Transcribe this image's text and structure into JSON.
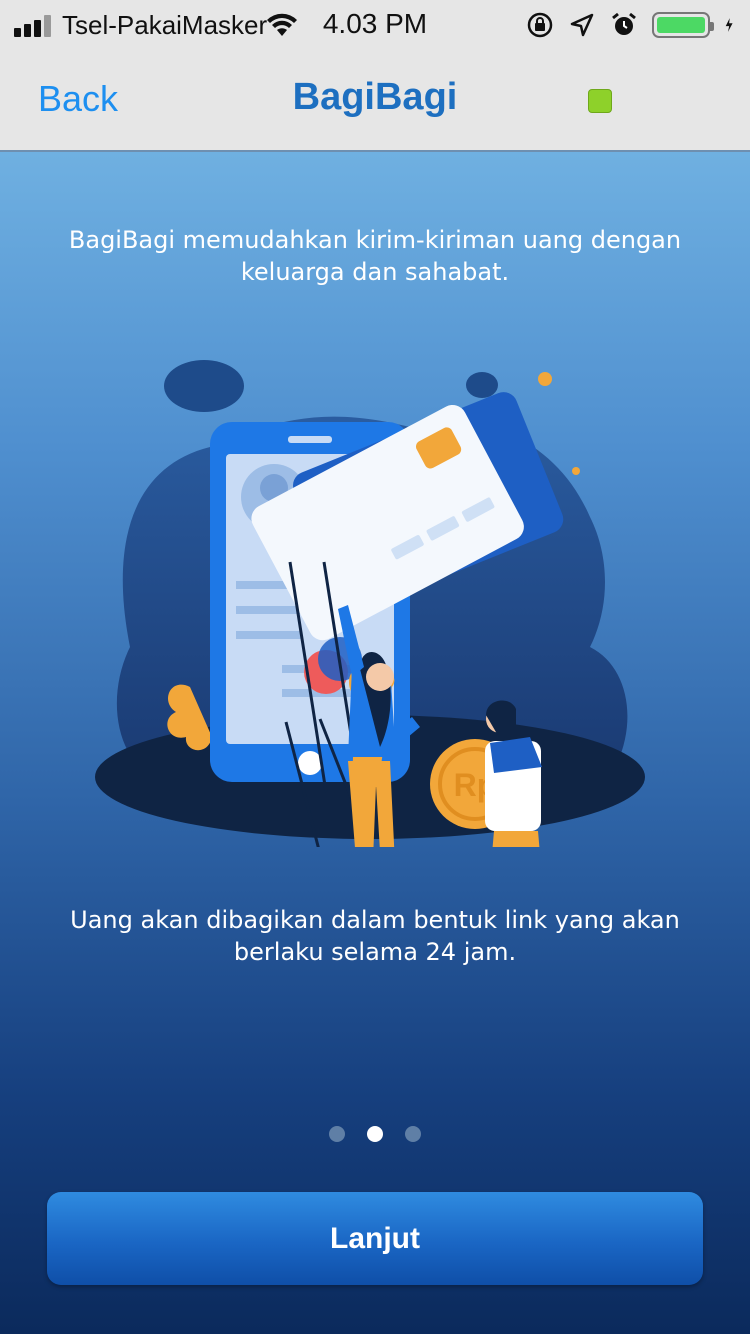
{
  "status_bar": {
    "carrier": "Tsel-PakaiMasker",
    "time": "4.03 PM",
    "icons": [
      "signal-icon",
      "wifi-icon",
      "rotation-lock-icon",
      "location-icon",
      "alarm-icon",
      "battery-icon",
      "charging-icon"
    ]
  },
  "nav": {
    "back_label": "Back",
    "title": "BagiBagi",
    "indicator_color": "#8ed12a"
  },
  "onboarding": {
    "intro": "BagiBagi memudahkan kirim-kiriman uang dengan keluarga dan sahabat.",
    "illustration": "phone-card-money-illustration",
    "illustration_coin_text": "Rp",
    "info": "Uang akan dibagikan dalam bentuk link yang akan berlaku selama 24 jam.",
    "pages": 3,
    "active_page": 2
  },
  "actions": {
    "next_label": "Lanjut"
  },
  "colors": {
    "accent": "#1d8ff0",
    "title": "#1d6fc0",
    "button": "#1a66c4"
  }
}
